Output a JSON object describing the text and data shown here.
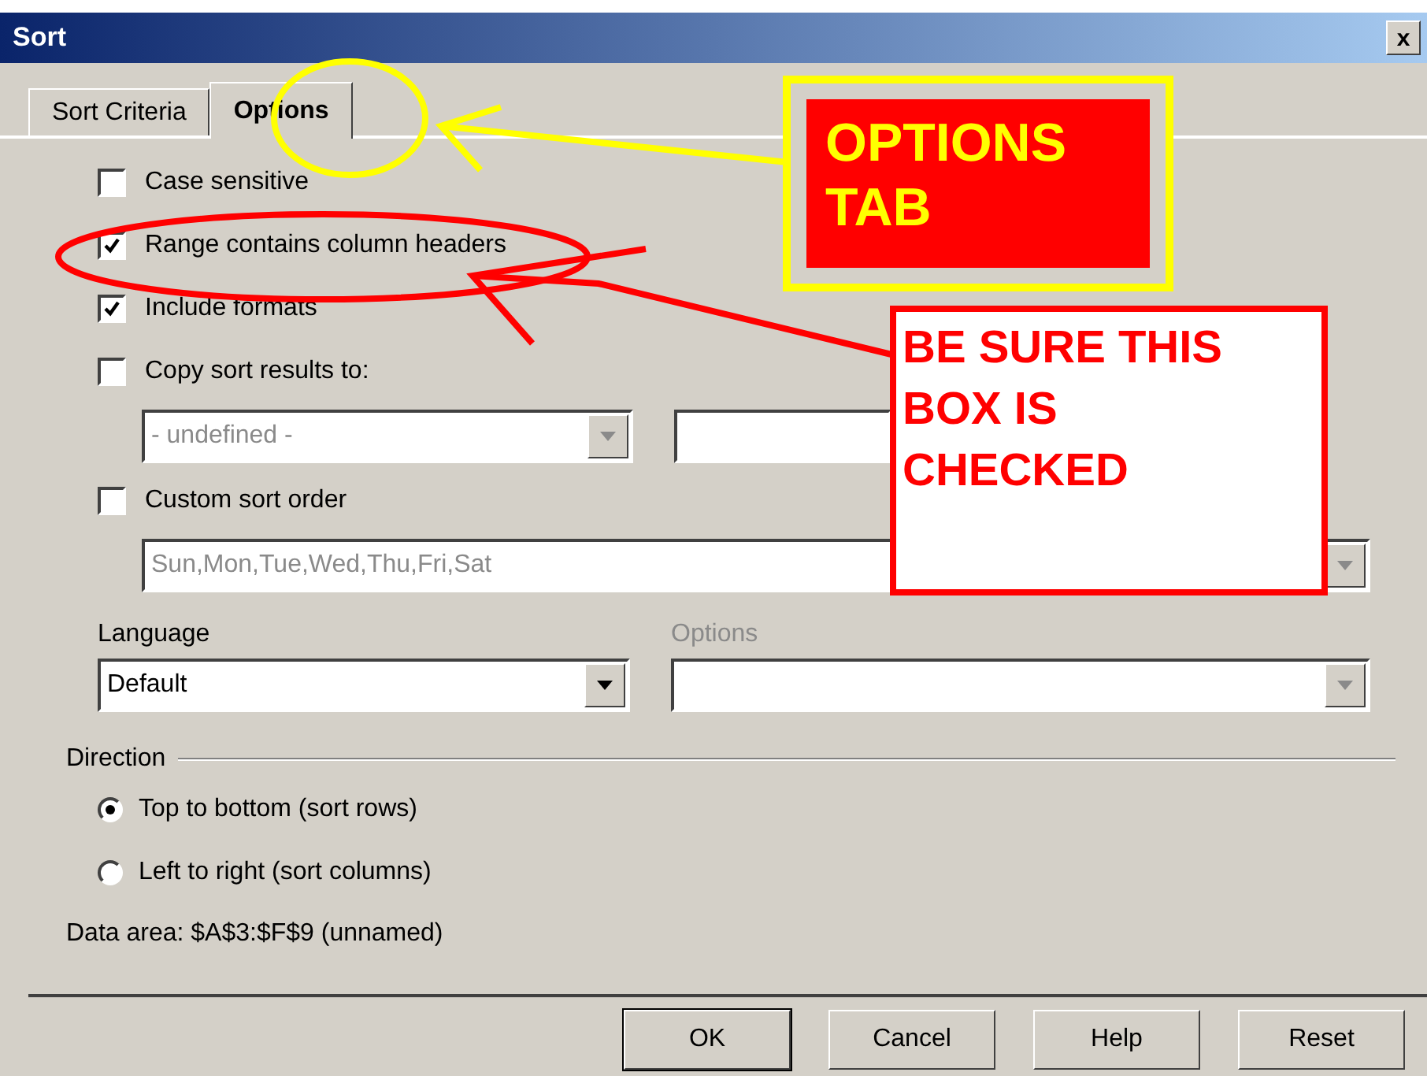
{
  "window": {
    "title": "Sort",
    "close": "x"
  },
  "tabs": [
    {
      "label": "Sort Criteria",
      "selected": false
    },
    {
      "label": "Options",
      "selected": true
    }
  ],
  "checkboxes": [
    {
      "label": "Case sensitive",
      "checked": false
    },
    {
      "label": "Range contains column headers",
      "checked": true
    },
    {
      "label": "Include formats",
      "checked": true
    }
  ],
  "copy_results": {
    "label": "Copy sort results to:",
    "checked": false,
    "area_select": {
      "value": "- undefined -",
      "disabled": true
    }
  },
  "custom_order": {
    "label": "Custom sort order",
    "checked": false,
    "select": {
      "value": "Sun,Mon,Tue,Wed,Thu,Fri,Sat",
      "disabled": true
    }
  },
  "language": {
    "label": "Language",
    "select": {
      "value": "Default",
      "disabled": false
    }
  },
  "language_options": {
    "label": "Options",
    "disabled": true
  },
  "direction": {
    "label": "Direction",
    "radios": [
      {
        "label": "Top to bottom (sort rows)",
        "selected": true
      },
      {
        "label": "Left to right (sort columns)",
        "selected": false
      }
    ]
  },
  "data_area": "Data area: $A$3:$F$9 (unnamed)",
  "buttons": [
    {
      "label": "OK",
      "default": true
    },
    {
      "label": "Cancel",
      "default": false
    },
    {
      "label": "Help",
      "default": false
    },
    {
      "label": "Reset",
      "default": false
    }
  ],
  "annotations": [
    {
      "kind": "yellow",
      "text": "OPTIONS TAB"
    },
    {
      "kind": "red",
      "text": "BE SURE THIS BOX IS CHECKED"
    }
  ]
}
